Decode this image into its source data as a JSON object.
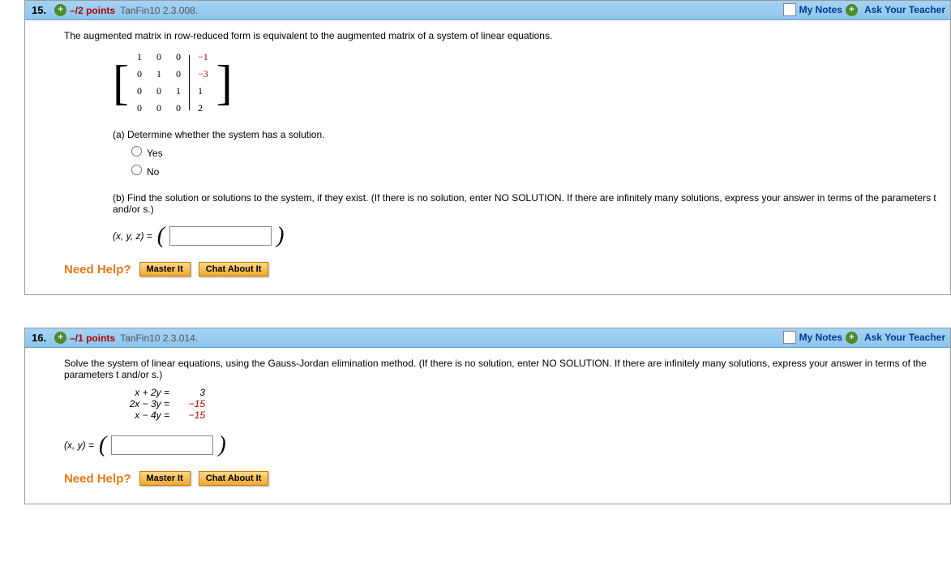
{
  "q15": {
    "num": "15.",
    "points": "–/2 points",
    "src": "TanFin10 2.3.008.",
    "mynotes": "My Notes",
    "ask": "Ask Your Teacher",
    "intro": "The augmented matrix in row-reduced form is equivalent to the augmented matrix of a system of linear equations.",
    "matrix": {
      "r1": [
        "1",
        "0",
        "0",
        "−1"
      ],
      "r2": [
        "0",
        "1",
        "0",
        "−3"
      ],
      "r3": [
        "0",
        "0",
        "1",
        "1"
      ],
      "r4": [
        "0",
        "0",
        "0",
        "2"
      ]
    },
    "a_prompt": "(a) Determine whether the system has a solution.",
    "yes": "Yes",
    "no": "No",
    "b_prompt": "(b) Find the solution or solutions to the system, if they exist. (If there is no solution, enter NO SOLUTION. If there are infinitely many solutions, express your answer in terms of the parameters t and/or s.)",
    "tuple": "(x, y, z) = ",
    "help": "Need Help?",
    "master": "Master It",
    "chat": "Chat About It"
  },
  "q16": {
    "num": "16.",
    "points": "–/1 points",
    "src": "TanFin10 2.3.014.",
    "mynotes": "My Notes",
    "ask": "Ask Your Teacher",
    "intro": "Solve the system of linear equations, using the Gauss-Jordan elimination method. (If there is no solution, enter NO SOLUTION. If there are infinitely many solutions, express your answer in terms of the parameters t and/or s.)",
    "eq1l": "x + 2y =",
    "eq1r": "3",
    "eq2l": "2x − 3y =",
    "eq2r": "−15",
    "eq3l": "x − 4y =",
    "eq3r": "−15",
    "tuple": "(x, y) = ",
    "help": "Need Help?",
    "master": "Master It",
    "chat": "Chat About It"
  }
}
